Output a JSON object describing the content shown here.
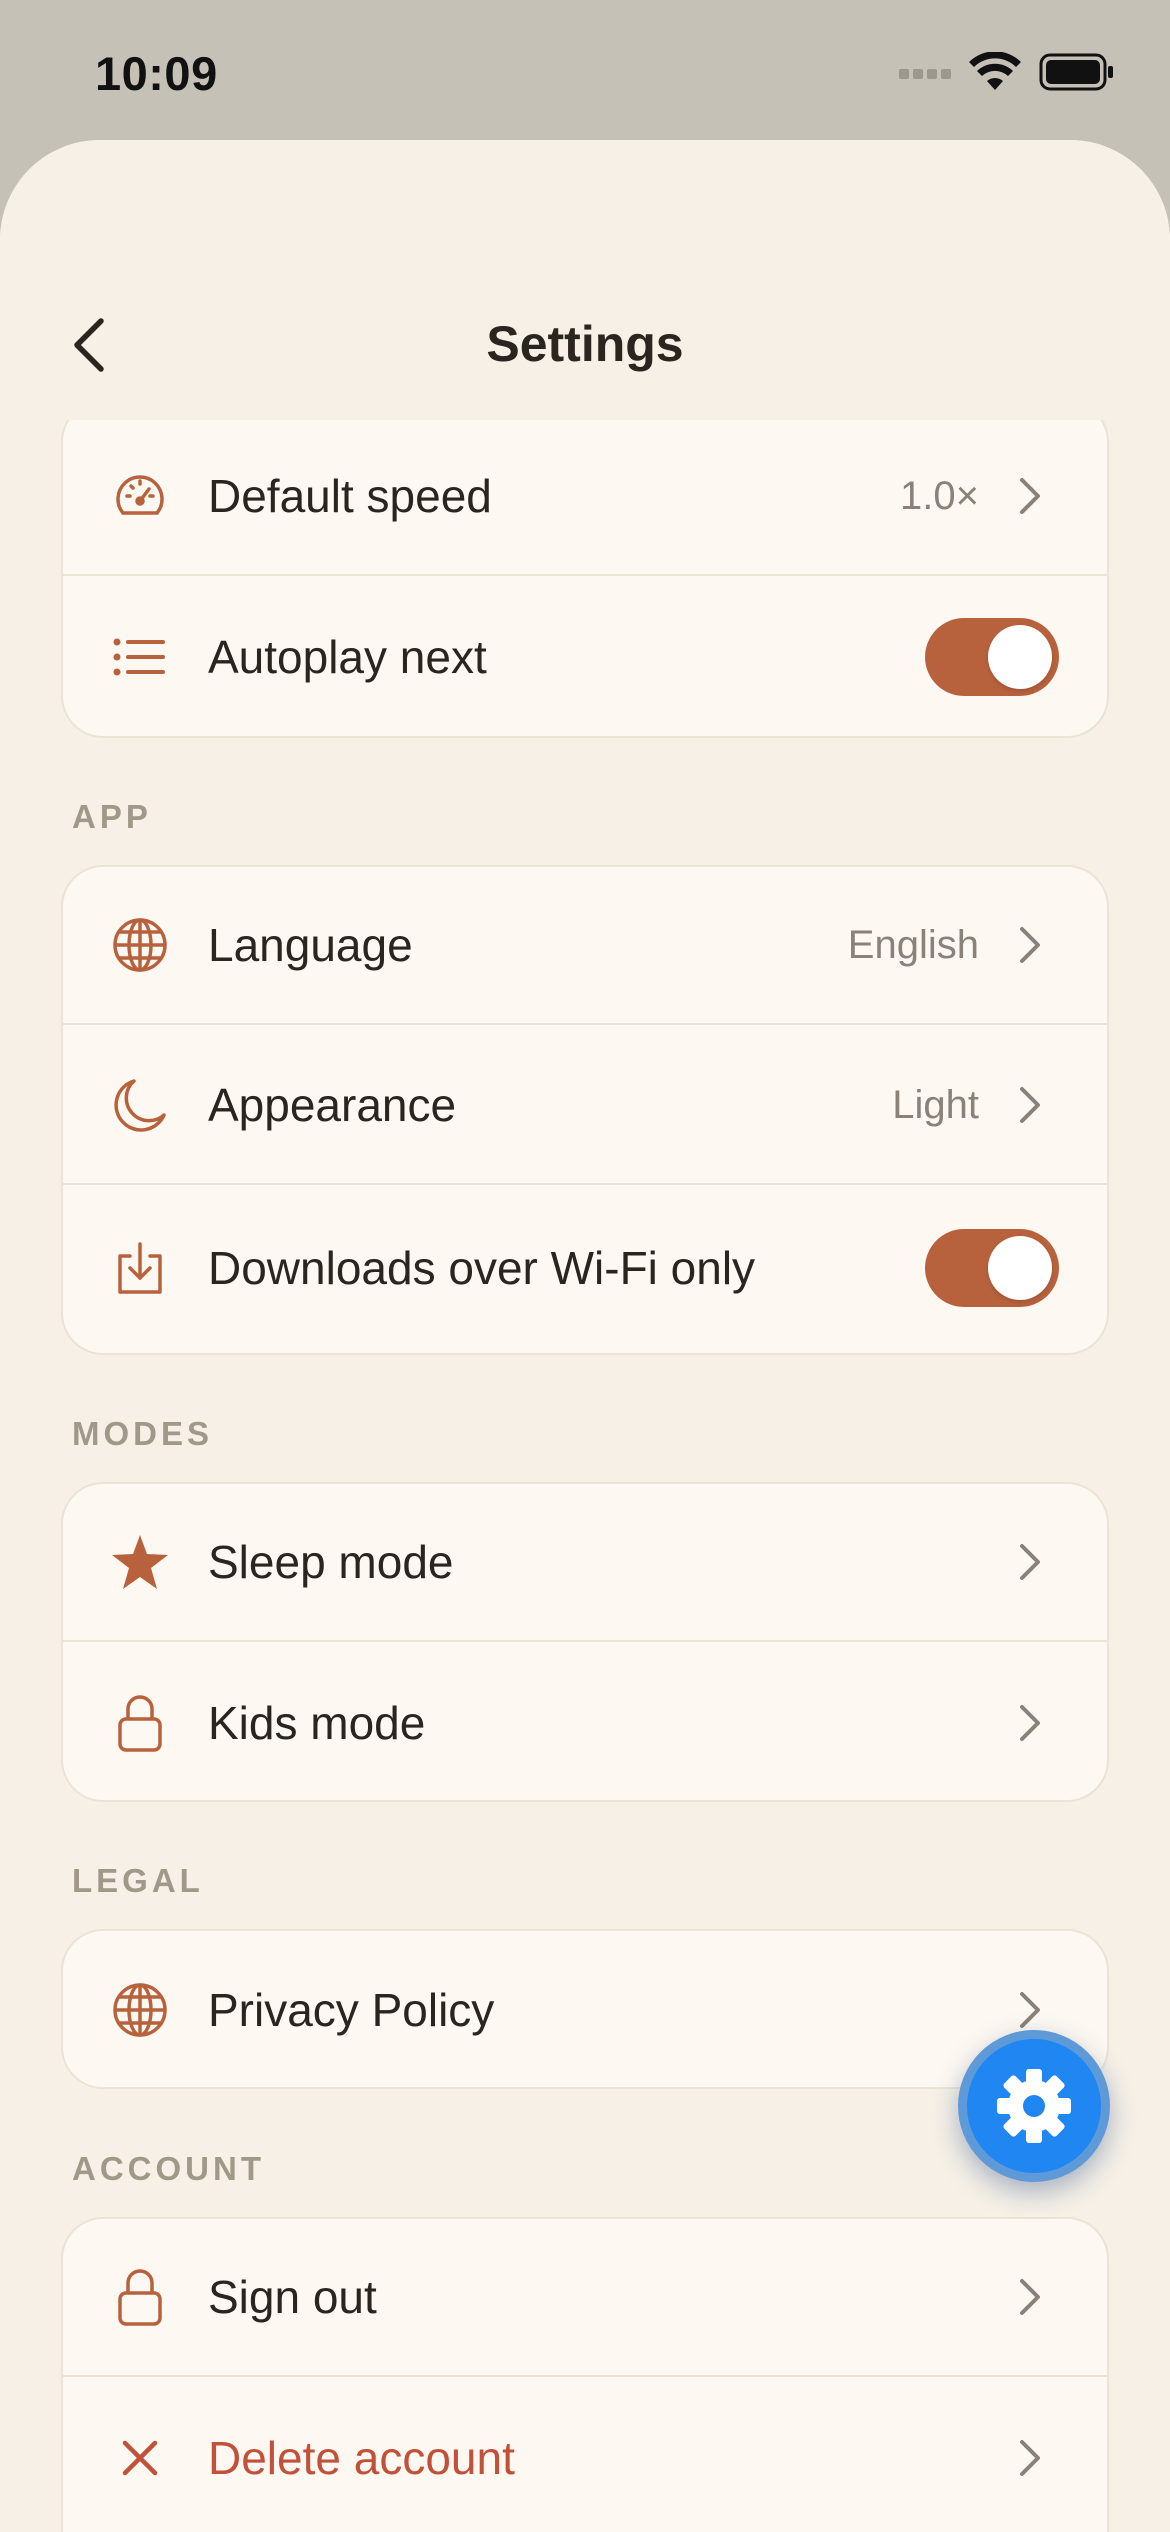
{
  "status_bar": {
    "time": "10:09"
  },
  "header": {
    "title": "Settings"
  },
  "colors": {
    "accent": "#b8623d",
    "danger": "#c2513a",
    "fab": "#1f86f2"
  },
  "playback": {
    "default_speed": {
      "label": "Default speed",
      "value": "1.0×",
      "icon": "speedometer-icon"
    },
    "autoplay_next": {
      "label": "Autoplay next",
      "enabled": true,
      "icon": "list-icon"
    }
  },
  "sections": {
    "app": "APP",
    "modes": "MODES",
    "legal": "LEGAL",
    "account": "ACCOUNT"
  },
  "app": {
    "language": {
      "label": "Language",
      "value": "English",
      "icon": "globe-icon"
    },
    "appearance": {
      "label": "Appearance",
      "value": "Light",
      "icon": "moon-icon"
    },
    "downloads_wifi": {
      "label": "Downloads over Wi-Fi only",
      "enabled": true,
      "icon": "download-icon"
    }
  },
  "modes": {
    "sleep": {
      "label": "Sleep mode",
      "icon": "star-icon"
    },
    "kids": {
      "label": "Kids mode",
      "icon": "lock-icon"
    }
  },
  "legal": {
    "privacy": {
      "label": "Privacy Policy",
      "icon": "globe-icon"
    }
  },
  "account": {
    "sign_out": {
      "label": "Sign out",
      "icon": "lock-icon"
    },
    "delete": {
      "label": "Delete account",
      "icon": "close-icon"
    }
  },
  "fab": {
    "icon": "gear-icon"
  }
}
